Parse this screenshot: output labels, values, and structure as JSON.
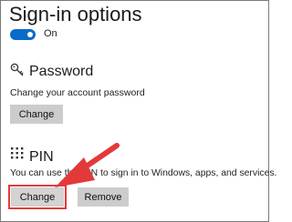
{
  "page_title": "Sign-in options",
  "toggle": {
    "label": "On",
    "state": "on",
    "color": "#0b6bc9"
  },
  "password": {
    "icon": "key-icon",
    "title": "Password",
    "description": "Change your account password",
    "change_label": "Change"
  },
  "pin": {
    "icon": "pin-keypad-icon",
    "title": "PIN",
    "description": "You can use this PIN to sign in to Windows, apps, and services.",
    "change_label": "Change",
    "remove_label": "Remove"
  },
  "annotation": {
    "color": "#e23a3a",
    "target": "pin-change-button"
  }
}
